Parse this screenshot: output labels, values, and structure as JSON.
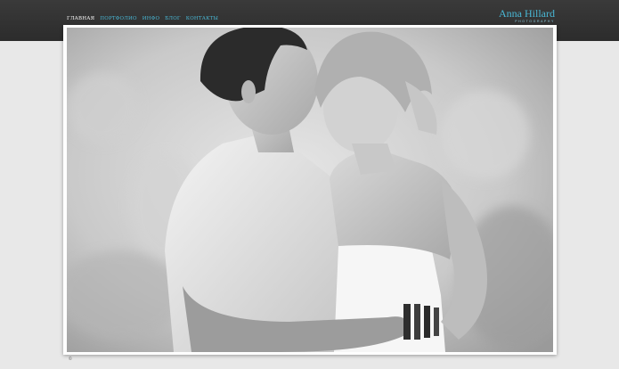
{
  "header": {
    "nav": [
      {
        "label": "ГЛАВНАЯ",
        "active": true
      },
      {
        "label": "ПОРТФОЛИО",
        "active": false
      },
      {
        "label": "ИНФО",
        "active": false
      },
      {
        "label": "БЛОГ",
        "active": false
      },
      {
        "label": "КОНТАКТЫ",
        "active": false
      }
    ],
    "logo_name": "Anna Hillard",
    "logo_sub": "PHOTOGRAPHY"
  },
  "footer": {
    "copyright": "©"
  },
  "colors": {
    "accent": "#49b8d6",
    "header_bg": "#2f2f2f",
    "page_bg": "#e8e8e8"
  }
}
